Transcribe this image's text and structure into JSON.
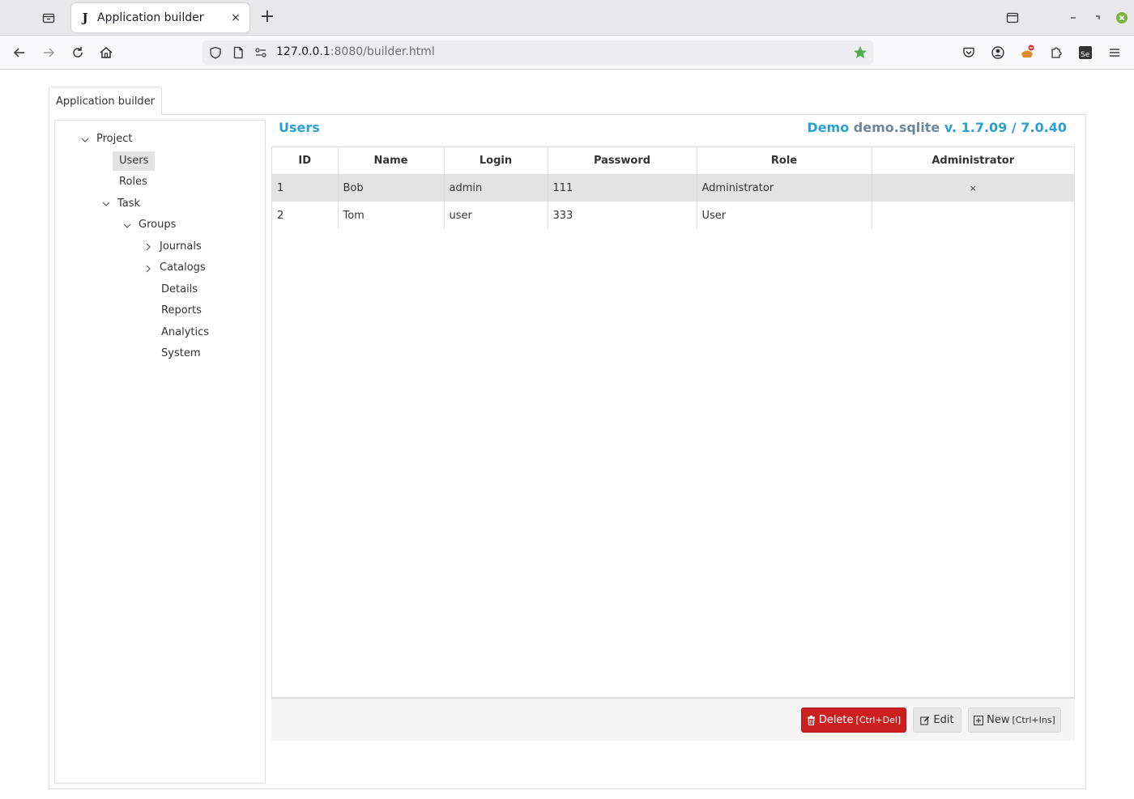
{
  "browser": {
    "tab_title": "Application builder",
    "tab_favicon": "J",
    "url_host": "127.0.0.1",
    "url_rest": ":8080/builder.html",
    "tab_close": "×",
    "new_tab": "+"
  },
  "page": {
    "tab_label": "Application builder"
  },
  "tree": {
    "nodes": [
      {
        "label": "Project",
        "expanded": true
      },
      {
        "label": "Users",
        "selected": true
      },
      {
        "label": "Roles"
      },
      {
        "label": "Task",
        "expanded": true
      },
      {
        "label": "Groups",
        "expanded": true
      },
      {
        "label": "Journals",
        "expanded": false
      },
      {
        "label": "Catalogs",
        "expanded": false
      },
      {
        "label": "Details"
      },
      {
        "label": "Reports"
      },
      {
        "label": "Analytics"
      },
      {
        "label": "System"
      }
    ]
  },
  "grid": {
    "title": "Users",
    "version_app": "Demo",
    "version_db": "demo.sqlite",
    "version_rest": "v. 1.7.09 / 7.0.40",
    "columns": [
      "ID",
      "Name",
      "Login",
      "Password",
      "Role",
      "Administrator"
    ],
    "rows": [
      {
        "id": "1",
        "name": "Bob",
        "login": "admin",
        "password": "111",
        "role": "Administrator",
        "admin": "×",
        "selected": true
      },
      {
        "id": "2",
        "name": "Tom",
        "login": "user",
        "password": "333",
        "role": "User",
        "admin": ""
      }
    ]
  },
  "buttons": {
    "delete_label": "Delete",
    "delete_shortcut": "[Ctrl+Del]",
    "edit_label": "Edit",
    "new_label": "New",
    "new_shortcut": "[Ctrl+Ins]"
  },
  "colors": {
    "accent": "#2a9fd6",
    "danger": "#cc1f1f",
    "bookmark_star": "#4caf50"
  }
}
